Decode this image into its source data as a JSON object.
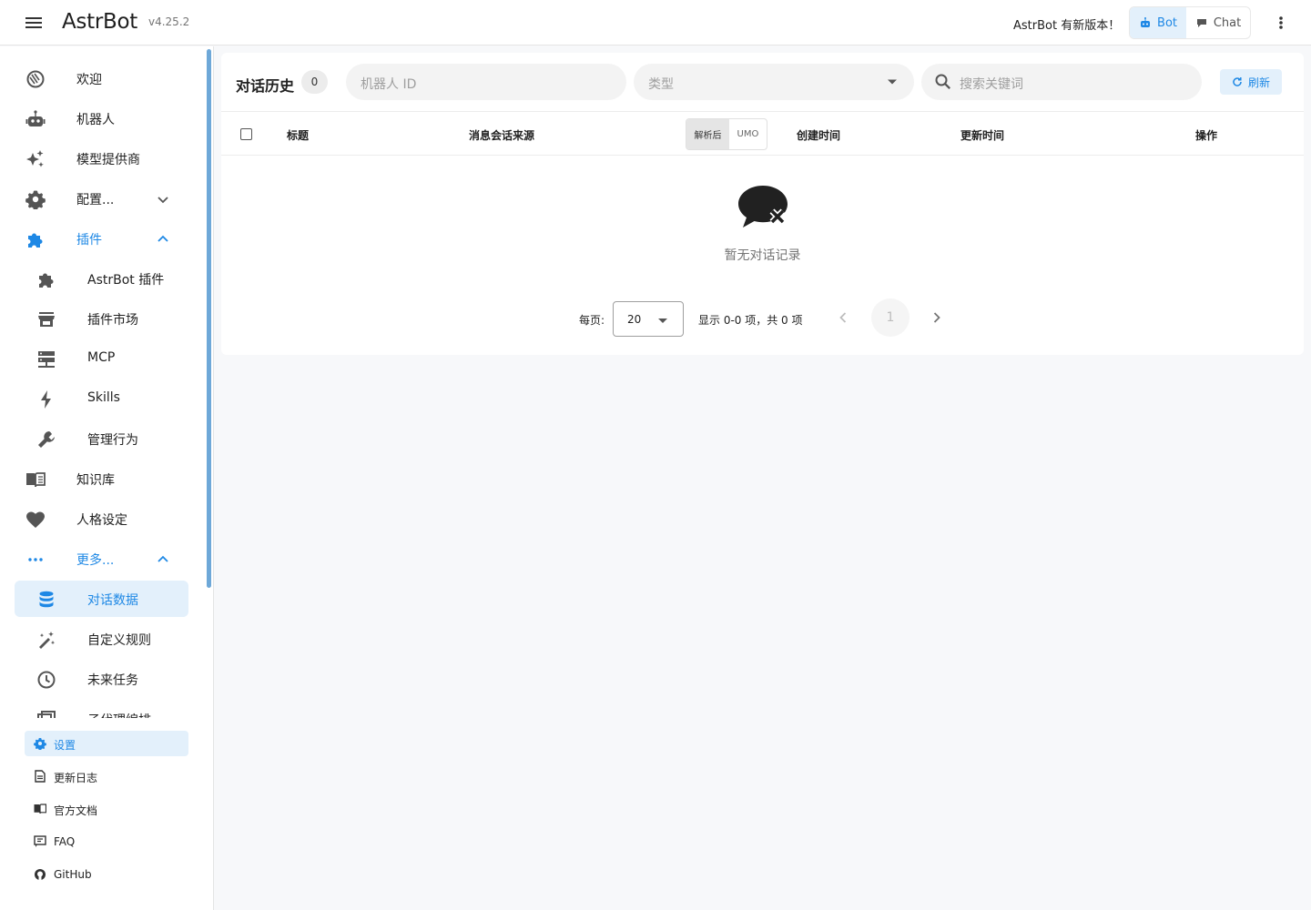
{
  "header": {
    "app_name": "AstrBot",
    "version": "v4.25.2",
    "update_notice": "AstrBot 有新版本！",
    "mode_bot": "Bot",
    "mode_chat": "Chat"
  },
  "sidebar": {
    "items": [
      {
        "label": "欢迎",
        "icon": "welcome-icon"
      },
      {
        "label": "机器人",
        "icon": "robot-icon"
      },
      {
        "label": "模型提供商",
        "icon": "sparkles-icon"
      },
      {
        "label": "配置...",
        "icon": "gear-icon"
      },
      {
        "label": "插件",
        "icon": "puzzle-icon"
      },
      {
        "label": "AstrBot 插件",
        "icon": "puzzle-icon"
      },
      {
        "label": "插件市场",
        "icon": "store-icon"
      },
      {
        "label": "MCP",
        "icon": "server-icon"
      },
      {
        "label": "Skills",
        "icon": "lightning-icon"
      },
      {
        "label": "管理行为",
        "icon": "wrench-icon"
      },
      {
        "label": "知识库",
        "icon": "book-icon"
      },
      {
        "label": "人格设定",
        "icon": "heart-icon"
      },
      {
        "label": "更多...",
        "icon": "dots-icon"
      },
      {
        "label": "对话数据",
        "icon": "database-icon"
      },
      {
        "label": "自定义规则",
        "icon": "magic-wand-icon"
      },
      {
        "label": "未来任务",
        "icon": "clock-icon"
      },
      {
        "label": "子代理编排",
        "icon": "subagent-icon"
      }
    ],
    "bottom": [
      {
        "label": "设置",
        "icon": "gear-icon"
      },
      {
        "label": "更新日志",
        "icon": "document-icon"
      },
      {
        "label": "官方文档",
        "icon": "book-icon"
      },
      {
        "label": "FAQ",
        "icon": "faq-icon"
      },
      {
        "label": "GitHub",
        "icon": "github-icon"
      }
    ]
  },
  "main": {
    "title": "对话历史",
    "count": "0",
    "filters": {
      "bot_id_placeholder": "机器人 ID",
      "type_placeholder": "类型",
      "search_placeholder": "搜索关键词"
    },
    "refresh_label": "刷新",
    "table": {
      "columns": [
        "标题",
        "消息会话来源",
        "创建时间",
        "更新时间",
        "操作"
      ],
      "source_toggle": [
        "解析后",
        "UMO"
      ]
    },
    "empty_text": "暂无对话记录",
    "pagination": {
      "per_page_label": "每页:",
      "per_page_value": "20",
      "range_text": "显示 0-0 项，共 0 项",
      "current_page": "1"
    }
  },
  "colors": {
    "accent": "#1e88e5",
    "active_bg": "#e3f0fb"
  }
}
